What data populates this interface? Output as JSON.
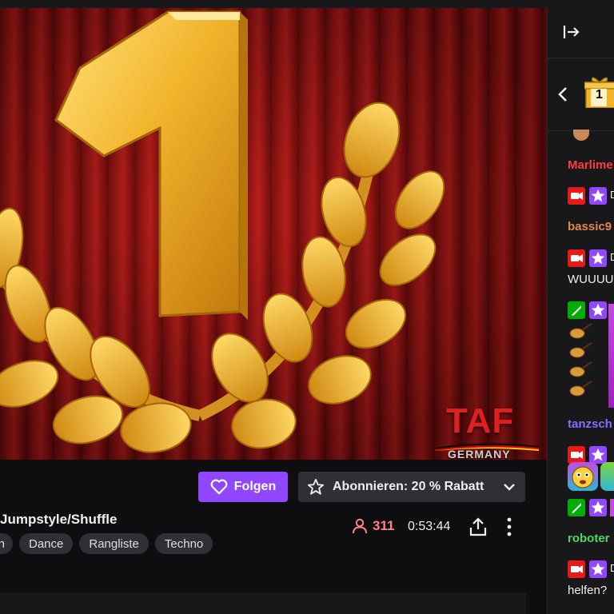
{
  "video": {
    "overlay_title": "TAF",
    "overlay_subtitle": "GERMANY"
  },
  "channel": {
    "follow_label": "Folgen",
    "subscribe_label": "Abonnieren: 20 % Rabatt",
    "stream_title": "Jumpstyle/Shuffle",
    "tags": [
      "n",
      "Dance",
      "Rangliste",
      "Techno"
    ],
    "viewer_count": "311",
    "uptime": "0:53:44"
  },
  "chat": {
    "gift_count": "1",
    "messages": [
      {
        "username": "Marlime",
        "text": "",
        "color": "#ff3b3b"
      },
      {
        "username": "",
        "text": "D",
        "color": "#efeff1"
      },
      {
        "username": "bassic9",
        "text": "",
        "color": "#e0884a"
      },
      {
        "username": "",
        "text": "D",
        "color": "#efeff1"
      },
      {
        "username": "",
        "text": "WUUUU",
        "color": "#efeff1"
      },
      {
        "username": "tanzsch",
        "text": "",
        "color": "#8a6cff"
      },
      {
        "username": "roboter",
        "text": "",
        "color": "#4cd964"
      },
      {
        "username": "",
        "text": "D",
        "color": "#efeff1"
      },
      {
        "username": "",
        "text": "helfen?",
        "color": "#efeff1"
      }
    ]
  },
  "colors": {
    "accent": "#9147ff",
    "viewer": "#ff8280",
    "background": "#0e0e10",
    "chat_bg": "#18181b"
  },
  "icons": [
    "heart-icon",
    "star-icon",
    "chevron-down-icon",
    "person-icon",
    "share-icon",
    "more-vertical-icon",
    "collapse-icon",
    "back-icon",
    "gift-icon",
    "moderator-badge-icon",
    "subscriber-badge-icon",
    "vip-badge-icon"
  ]
}
